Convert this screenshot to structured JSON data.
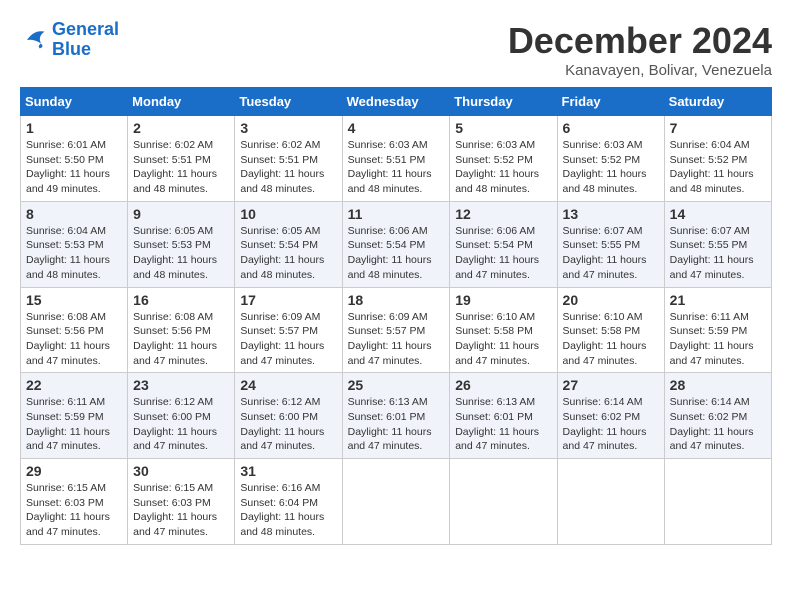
{
  "logo": {
    "line1": "General",
    "line2": "Blue"
  },
  "title": "December 2024",
  "location": "Kanavayen, Bolivar, Venezuela",
  "days_of_week": [
    "Sunday",
    "Monday",
    "Tuesday",
    "Wednesday",
    "Thursday",
    "Friday",
    "Saturday"
  ],
  "weeks": [
    [
      {
        "day": "1",
        "sunrise": "6:01 AM",
        "sunset": "5:50 PM",
        "daylight": "11 hours and 49 minutes."
      },
      {
        "day": "2",
        "sunrise": "6:02 AM",
        "sunset": "5:51 PM",
        "daylight": "11 hours and 48 minutes."
      },
      {
        "day": "3",
        "sunrise": "6:02 AM",
        "sunset": "5:51 PM",
        "daylight": "11 hours and 48 minutes."
      },
      {
        "day": "4",
        "sunrise": "6:03 AM",
        "sunset": "5:51 PM",
        "daylight": "11 hours and 48 minutes."
      },
      {
        "day": "5",
        "sunrise": "6:03 AM",
        "sunset": "5:52 PM",
        "daylight": "11 hours and 48 minutes."
      },
      {
        "day": "6",
        "sunrise": "6:03 AM",
        "sunset": "5:52 PM",
        "daylight": "11 hours and 48 minutes."
      },
      {
        "day": "7",
        "sunrise": "6:04 AM",
        "sunset": "5:52 PM",
        "daylight": "11 hours and 48 minutes."
      }
    ],
    [
      {
        "day": "8",
        "sunrise": "6:04 AM",
        "sunset": "5:53 PM",
        "daylight": "11 hours and 48 minutes."
      },
      {
        "day": "9",
        "sunrise": "6:05 AM",
        "sunset": "5:53 PM",
        "daylight": "11 hours and 48 minutes."
      },
      {
        "day": "10",
        "sunrise": "6:05 AM",
        "sunset": "5:54 PM",
        "daylight": "11 hours and 48 minutes."
      },
      {
        "day": "11",
        "sunrise": "6:06 AM",
        "sunset": "5:54 PM",
        "daylight": "11 hours and 48 minutes."
      },
      {
        "day": "12",
        "sunrise": "6:06 AM",
        "sunset": "5:54 PM",
        "daylight": "11 hours and 47 minutes."
      },
      {
        "day": "13",
        "sunrise": "6:07 AM",
        "sunset": "5:55 PM",
        "daylight": "11 hours and 47 minutes."
      },
      {
        "day": "14",
        "sunrise": "6:07 AM",
        "sunset": "5:55 PM",
        "daylight": "11 hours and 47 minutes."
      }
    ],
    [
      {
        "day": "15",
        "sunrise": "6:08 AM",
        "sunset": "5:56 PM",
        "daylight": "11 hours and 47 minutes."
      },
      {
        "day": "16",
        "sunrise": "6:08 AM",
        "sunset": "5:56 PM",
        "daylight": "11 hours and 47 minutes."
      },
      {
        "day": "17",
        "sunrise": "6:09 AM",
        "sunset": "5:57 PM",
        "daylight": "11 hours and 47 minutes."
      },
      {
        "day": "18",
        "sunrise": "6:09 AM",
        "sunset": "5:57 PM",
        "daylight": "11 hours and 47 minutes."
      },
      {
        "day": "19",
        "sunrise": "6:10 AM",
        "sunset": "5:58 PM",
        "daylight": "11 hours and 47 minutes."
      },
      {
        "day": "20",
        "sunrise": "6:10 AM",
        "sunset": "5:58 PM",
        "daylight": "11 hours and 47 minutes."
      },
      {
        "day": "21",
        "sunrise": "6:11 AM",
        "sunset": "5:59 PM",
        "daylight": "11 hours and 47 minutes."
      }
    ],
    [
      {
        "day": "22",
        "sunrise": "6:11 AM",
        "sunset": "5:59 PM",
        "daylight": "11 hours and 47 minutes."
      },
      {
        "day": "23",
        "sunrise": "6:12 AM",
        "sunset": "6:00 PM",
        "daylight": "11 hours and 47 minutes."
      },
      {
        "day": "24",
        "sunrise": "6:12 AM",
        "sunset": "6:00 PM",
        "daylight": "11 hours and 47 minutes."
      },
      {
        "day": "25",
        "sunrise": "6:13 AM",
        "sunset": "6:01 PM",
        "daylight": "11 hours and 47 minutes."
      },
      {
        "day": "26",
        "sunrise": "6:13 AM",
        "sunset": "6:01 PM",
        "daylight": "11 hours and 47 minutes."
      },
      {
        "day": "27",
        "sunrise": "6:14 AM",
        "sunset": "6:02 PM",
        "daylight": "11 hours and 47 minutes."
      },
      {
        "day": "28",
        "sunrise": "6:14 AM",
        "sunset": "6:02 PM",
        "daylight": "11 hours and 47 minutes."
      }
    ],
    [
      {
        "day": "29",
        "sunrise": "6:15 AM",
        "sunset": "6:03 PM",
        "daylight": "11 hours and 47 minutes."
      },
      {
        "day": "30",
        "sunrise": "6:15 AM",
        "sunset": "6:03 PM",
        "daylight": "11 hours and 47 minutes."
      },
      {
        "day": "31",
        "sunrise": "6:16 AM",
        "sunset": "6:04 PM",
        "daylight": "11 hours and 48 minutes."
      },
      null,
      null,
      null,
      null
    ]
  ]
}
